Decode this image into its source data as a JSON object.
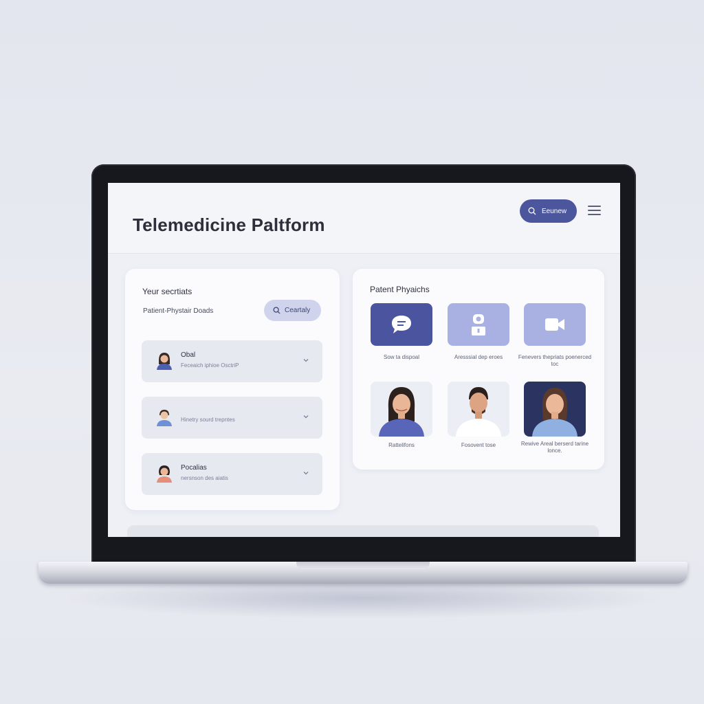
{
  "header": {
    "title": "Telemedicine Paltform",
    "button_label": "Eeunew",
    "button_icon": "search-icon",
    "menu_icon": "hamburger-menu-icon"
  },
  "left_panel": {
    "heading": "Yeur secrtiats",
    "sub_label": "Patient-Phystair Doads",
    "search_button_label": "Ceartaly",
    "rows": [
      {
        "title": "Obal",
        "desc": "Feceaich iphioe OsctriP"
      },
      {
        "title": "",
        "desc": "Hinetry sourd trepntes"
      },
      {
        "title": "Pocalias",
        "desc": "nersnson des aiatis"
      }
    ]
  },
  "right_panel": {
    "heading": "Patent Phyaichs",
    "tiles": [
      {
        "icon": "chat-bubble-icon",
        "caption": "Sow ta dispoal",
        "color": "#4b549f"
      },
      {
        "icon": "person-icon",
        "caption": "Aresssial dep eroes",
        "color": "#a9b0e2"
      },
      {
        "icon": "video-camera-icon",
        "caption": "Fenevers thepriats poenerced toc",
        "color": "#a9b0e2"
      }
    ],
    "doctors": [
      {
        "caption": "Rattelifons"
      },
      {
        "caption": "Fosovent tose"
      },
      {
        "caption": "Rewive Areal berserd tarine lonce."
      }
    ]
  },
  "colors": {
    "accent": "#4c569d",
    "accent_light": "#cfd4ec",
    "background": "#eef0f6"
  }
}
